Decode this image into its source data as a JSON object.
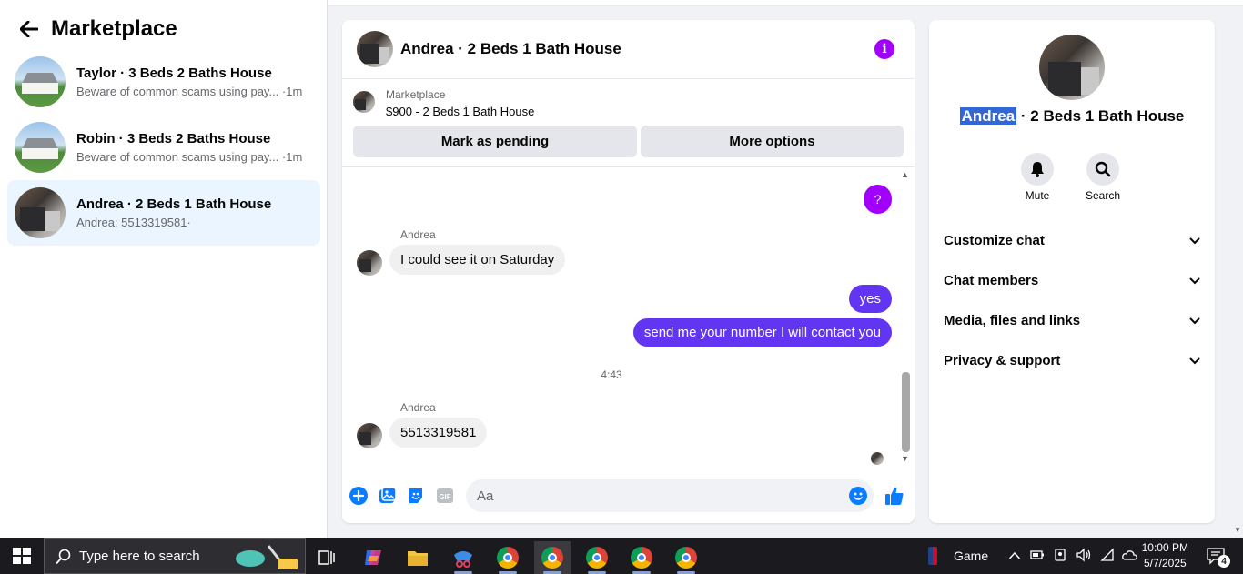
{
  "sidebar": {
    "title": "Marketplace",
    "conversations": [
      {
        "title": "Taylor · 3 Beds 2 Baths House",
        "subtitle": "Beware of common scams using pay...",
        "time": "·1m"
      },
      {
        "title": "Robin · 3 Beds 2 Baths House",
        "subtitle": "Beware of common scams using pay...",
        "time": "·1m"
      },
      {
        "title": "Andrea · 2 Beds 1 Bath House",
        "subtitle": "Andrea: 5513319581",
        "time": "·"
      }
    ]
  },
  "chat": {
    "title": "Andrea · 2 Beds 1 Bath House",
    "listing": {
      "label": "Marketplace",
      "price": "$900 - 2 Beds 1 Bath House",
      "mark_pending": "Mark as pending",
      "more_options": "More options"
    },
    "messages": {
      "question_bubble": "?",
      "sender1": "Andrea",
      "in1": "I could see it on Saturday",
      "out1": "yes",
      "out2": "send me your number I will contact you",
      "timestamp": "4:43",
      "sender2": "Andrea",
      "in2": "5513319581"
    },
    "composer": {
      "placeholder": "Aa"
    },
    "colors": {
      "accent": "#a100ff",
      "outgoing": "#6135f1",
      "like": "#0a7cff"
    }
  },
  "details": {
    "name_highlight": "Andrea",
    "name_rest": " · 2 Beds 1 Bath House",
    "actions": [
      {
        "label": "Mute",
        "icon": "bell-icon"
      },
      {
        "label": "Search",
        "icon": "search-icon"
      }
    ],
    "sections": [
      "Customize chat",
      "Chat members",
      "Media, files and links",
      "Privacy & support"
    ]
  },
  "taskbar": {
    "search_placeholder": "Type here to search",
    "game_label": "Game",
    "time": "10:00 PM",
    "date": "5/7/2025",
    "notifications": "4"
  }
}
